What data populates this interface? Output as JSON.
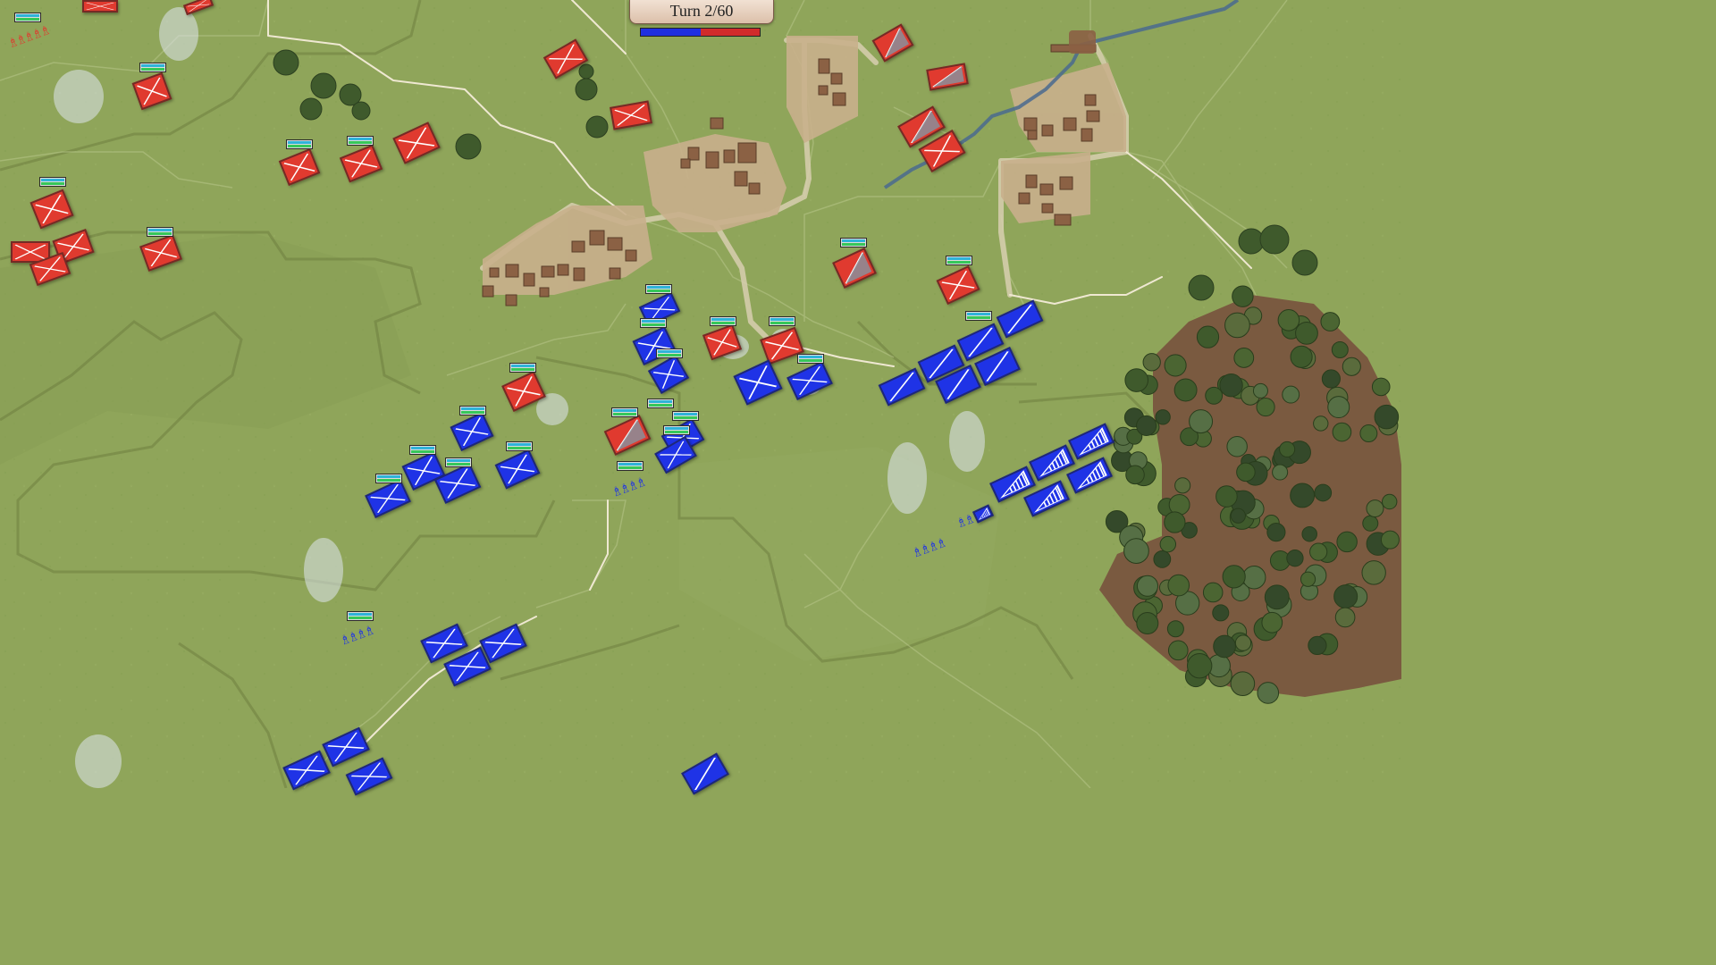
{
  "hud": {
    "turn_label": "Turn 2/60",
    "balance_blue_fraction": 0.5
  },
  "colors": {
    "red_army": "#e03a2f",
    "blue_army": "#1f33e6",
    "grass": "#8fa55a",
    "road": "#e6dcc4",
    "river": "#4a6a8f",
    "forest_floor": "#7a5a40"
  },
  "icons": {
    "infantry_marker": "x-cross",
    "cavalry_marker": "diagonal-slash",
    "artillery_marker": "triangle-stripes"
  }
}
